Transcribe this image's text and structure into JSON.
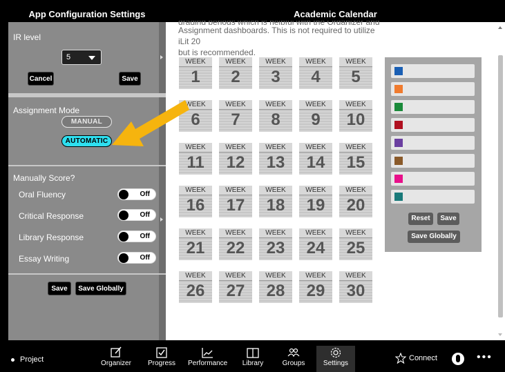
{
  "left_panel": {
    "title": "App Configuration Settings",
    "ir_level": {
      "label": "IR level",
      "value": "5",
      "cancel_label": "Cancel",
      "save_label": "Save"
    },
    "assignment_mode": {
      "label": "Assignment Mode",
      "manual_label": "MANUAL",
      "automatic_label": "AUTOMATIC",
      "selected": "AUTOMATIC"
    },
    "manual_score": {
      "label": "Manually Score?",
      "items": [
        {
          "label": "Oral Fluency",
          "state": "Off"
        },
        {
          "label": "Critical Response",
          "state": "Off"
        },
        {
          "label": "Library Response",
          "state": "Off"
        },
        {
          "label": "Essay Writing",
          "state": "Off"
        }
      ],
      "save_label": "Save",
      "save_globally_label": "Save Globally"
    }
  },
  "right_panel": {
    "title": "Academic Calendar",
    "intro_line_cut": "grading periods which is helpful with the Organizer and",
    "intro_line_2": "Assignment dashboards. This is not required to utilize iLit 20",
    "intro_line_3": "but is recommended.",
    "week_label": "WEEK",
    "weeks": [
      "1",
      "2",
      "3",
      "4",
      "5",
      "6",
      "7",
      "8",
      "9",
      "10",
      "11",
      "12",
      "13",
      "14",
      "15",
      "16",
      "17",
      "18",
      "19",
      "20",
      "21",
      "22",
      "23",
      "24",
      "25",
      "26",
      "27",
      "28",
      "29",
      "30"
    ],
    "colors": [
      "#1a5fb4",
      "#f07b2e",
      "#1a8a3a",
      "#b01020",
      "#6b3fa0",
      "#8a5a2a",
      "#e8108a",
      "#1a7a7a"
    ],
    "reset_label": "Reset",
    "save_label": "Save",
    "save_globally_label": "Save Globally"
  },
  "bottom_bar": {
    "project_label": "Project",
    "nav": [
      {
        "label": "Organizer",
        "icon": "pencil-square-icon"
      },
      {
        "label": "Progress",
        "icon": "checkbox-icon"
      },
      {
        "label": "Performance",
        "icon": "line-chart-icon"
      },
      {
        "label": "Library",
        "icon": "book-icon"
      },
      {
        "label": "Groups",
        "icon": "people-icon"
      },
      {
        "label": "Settings",
        "icon": "gear-icon"
      }
    ],
    "active": "Settings",
    "connect_label": "Connect",
    "more_label": "•••"
  }
}
